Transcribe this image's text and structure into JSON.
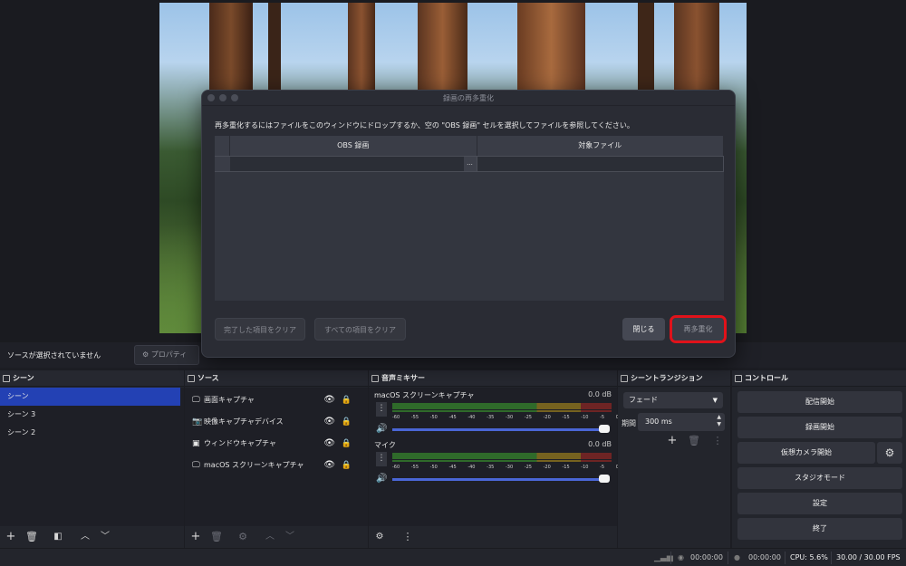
{
  "dialog": {
    "title": "録画の再多重化",
    "instruction": "再多重化するにはファイルをこのウィンドウにドロップするか、空の \"OBS 録画\" セルを選択してファイルを参照してください。",
    "columns": [
      "OBS 録画",
      "対象ファイル"
    ],
    "browse_label": "...",
    "buttons": {
      "clear_completed": "完了した項目をクリア",
      "clear_all": "すべての項目をクリア",
      "close": "閉じる",
      "remux": "再多重化"
    }
  },
  "context_bar": {
    "no_source": "ソースが選択されていません",
    "properties": "プロパティ"
  },
  "scenes": {
    "title": "シーン",
    "items": [
      "シーン",
      "シーン 3",
      "シーン 2"
    ],
    "selected_index": 0
  },
  "sources": {
    "title": "ソース",
    "items": [
      {
        "label": "画面キャプチャ",
        "icon": "monitor-icon"
      },
      {
        "label": "映像キャプチャデバイス",
        "icon": "camera-icon"
      },
      {
        "label": "ウィンドウキャプチャ",
        "icon": "window-icon"
      },
      {
        "label": "macOS スクリーンキャプチャ",
        "icon": "monitor-icon"
      }
    ]
  },
  "mixer": {
    "title": "音声ミキサー",
    "ticks": [
      "-60",
      "-55",
      "-50",
      "-45",
      "-40",
      "-35",
      "-30",
      "-25",
      "-20",
      "-15",
      "-10",
      "-5",
      "0"
    ],
    "channels": [
      {
        "name": "macOS スクリーンキャプチャ",
        "db": "0.0 dB",
        "volume": 1.0
      },
      {
        "name": "マイク",
        "db": "0.0 dB",
        "volume": 1.0
      }
    ]
  },
  "transitions": {
    "title": "シーントランジション",
    "selected": "フェード",
    "duration_label": "期間",
    "duration": "300 ms"
  },
  "controls": {
    "title": "コントロール",
    "start_streaming": "配信開始",
    "start_recording": "録画開始",
    "start_virtual_camera": "仮想カメラ開始",
    "studio_mode": "スタジオモード",
    "settings": "設定",
    "exit": "終了"
  },
  "status": {
    "stream_time": "00:00:00",
    "rec_time": "00:00:00",
    "cpu": "CPU: 5.6%",
    "fps": "30.00 / 30.00 FPS"
  },
  "colors": {
    "accent": "#2341b4",
    "highlight": "#e0121a",
    "slider": "#4a66d6"
  }
}
